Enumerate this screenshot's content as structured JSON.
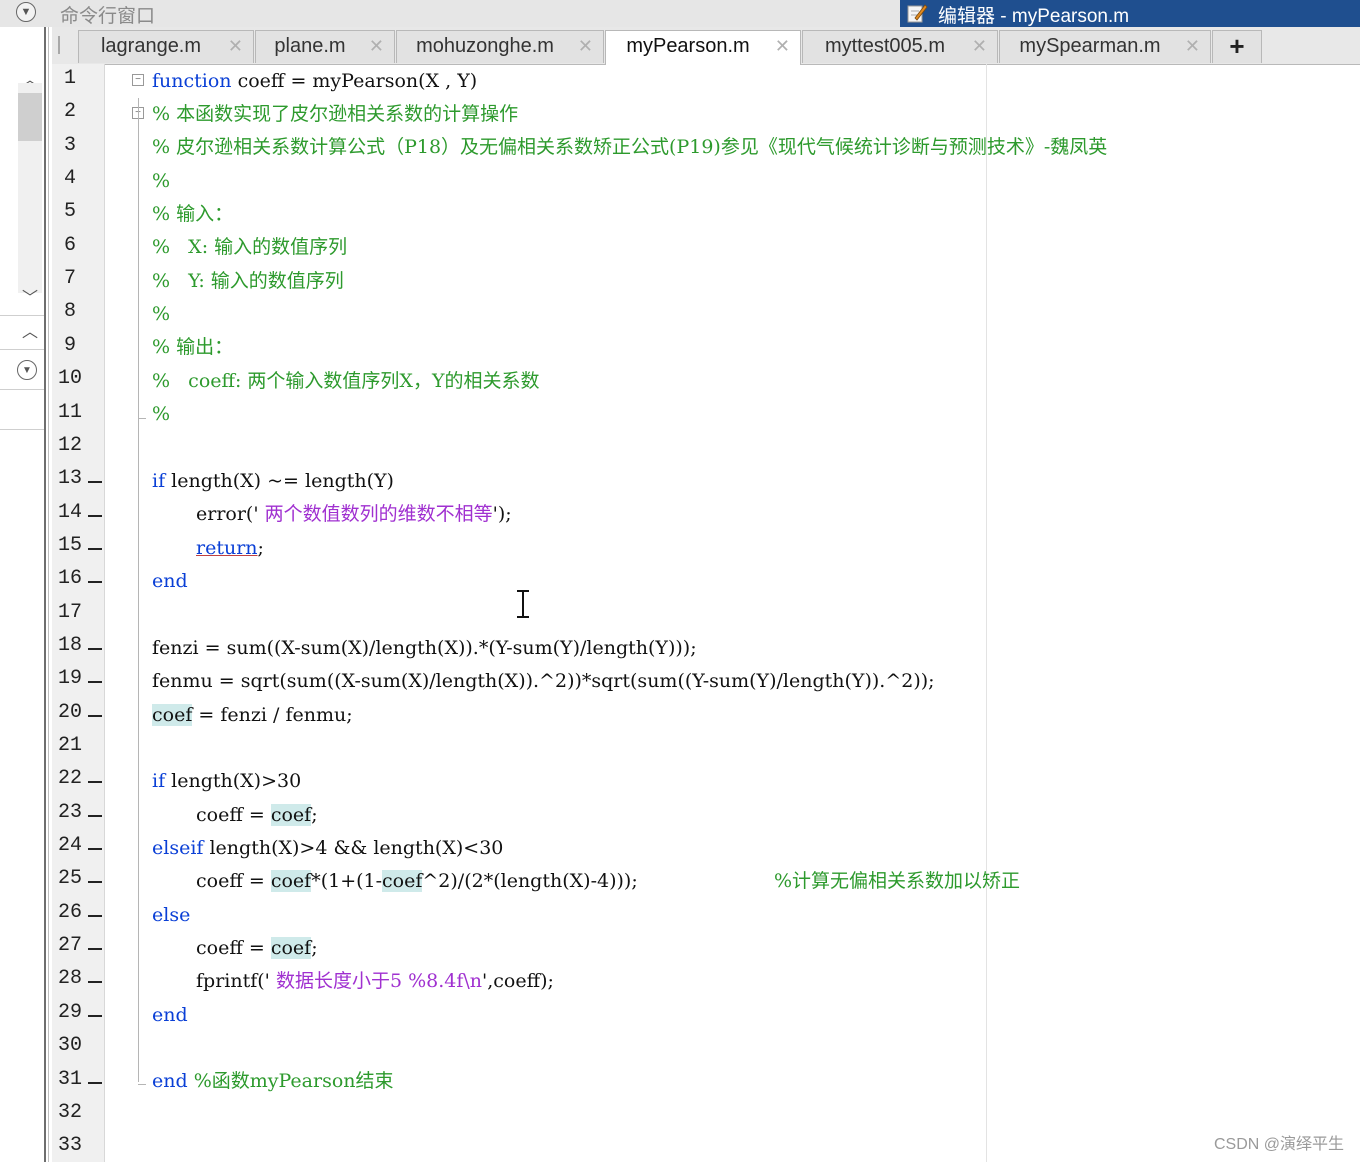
{
  "cmd_window": {
    "title": "命令行窗口"
  },
  "editor": {
    "title": "编辑器 - myPearson.m"
  },
  "tabs": [
    {
      "label": "lagrange.m"
    },
    {
      "label": "plane.m"
    },
    {
      "label": "mohuzonghe.m"
    },
    {
      "label": "myPearson.m",
      "active": true
    },
    {
      "label": "myttest005.m"
    },
    {
      "label": "mySpearman.m"
    }
  ],
  "new_tab_label": "+",
  "close_glyph": "✕",
  "line_numbers": [
    "1",
    "2",
    "3",
    "4",
    "5",
    "6",
    "7",
    "8",
    "9",
    "10",
    "11",
    "12",
    "13",
    "14",
    "15",
    "16",
    "17",
    "18",
    "19",
    "20",
    "21",
    "22",
    "23",
    "24",
    "25",
    "26",
    "27",
    "28",
    "29",
    "30",
    "31",
    "32",
    "33"
  ],
  "code": {
    "l1": {
      "kw": "function",
      "rest": " coeff = myPearson(X , Y)"
    },
    "l2": "% 本函数实现了皮尔逊相关系数的计算操作",
    "l3": "% 皮尔逊相关系数计算公式（P18）及无偏相关系数矫正公式(P19)参见《现代气候统计诊断与预测技术》-魏凤英",
    "l4": "%",
    "l5": "% 输入：",
    "l6": "%   X: 输入的数值序列",
    "l7": "%   Y: 输入的数值序列",
    "l8": "%",
    "l9": "% 输出：",
    "l10": "%   coeff: 两个输入数值序列X，Y的相关系数",
    "l11": "%",
    "l13": {
      "kw": "if",
      "rest": " length(X) ~= length(Y)"
    },
    "l14": {
      "a": "error('",
      "str": " 两个数值数列的维数不相等",
      "b": "');"
    },
    "l15": {
      "kw": "return",
      "rest": ";"
    },
    "l16": "end",
    "l18": "fenzi = sum((X-sum(X)/length(X)).*(Y-sum(Y)/length(Y)));",
    "l19": "fenmu = sqrt(sum((X-sum(X)/length(X)).^2))*sqrt(sum((Y-sum(Y)/length(Y)).^2));",
    "l20": {
      "hl": "coef",
      "rest": " = fenzi / fenmu;"
    },
    "l22": {
      "kw": "if",
      "rest": " length(X)>30"
    },
    "l23": {
      "a": "coeff = ",
      "hl": "coef",
      "b": ";"
    },
    "l24": {
      "kw": "elseif",
      "rest": " length(X)>4 && length(X)<30"
    },
    "l25": {
      "a": "coeff = ",
      "hl1": "coef",
      "b": "*(1+(1-",
      "hl2": "coef",
      "c": "^2)/(2*(length(X)-4)));",
      "comment": "%计算无偏相关系数加以矫正"
    },
    "l26": "else",
    "l27": {
      "a": "coeff = ",
      "hl": "coef",
      "b": ";"
    },
    "l28": {
      "a": "fprintf('",
      "str": " 数据长度小于5 %8.4f\\n",
      "b": "',coeff);"
    },
    "l29": "end",
    "l31": {
      "kw": "end",
      "comment": " %函数myPearson结束"
    }
  },
  "watermark": "CSDN @演绎平生"
}
